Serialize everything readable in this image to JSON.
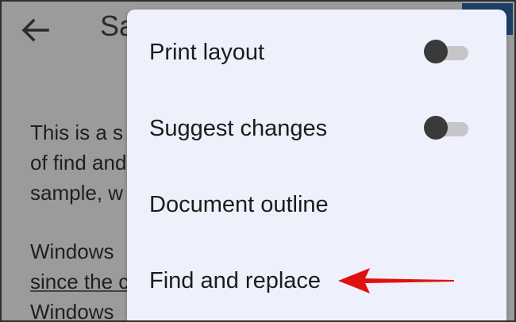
{
  "document": {
    "title_fragment": "Sa",
    "paragraph1": [
      "This is a s",
      "of find and",
      "sample, w"
    ],
    "paragraph2": [
      "Windows",
      "since the c",
      "Windows"
    ]
  },
  "menu": {
    "items": [
      {
        "label": "Print layout",
        "toggle": "off"
      },
      {
        "label": "Suggest changes",
        "toggle": "off"
      },
      {
        "label": "Document outline"
      },
      {
        "label": "Find and replace"
      }
    ]
  },
  "annotation": {
    "color": "#e01010"
  },
  "colors": {
    "menu_background": "#eef0fb",
    "scrim": "#9b9b9b",
    "accent_button": "#1d3f66"
  }
}
